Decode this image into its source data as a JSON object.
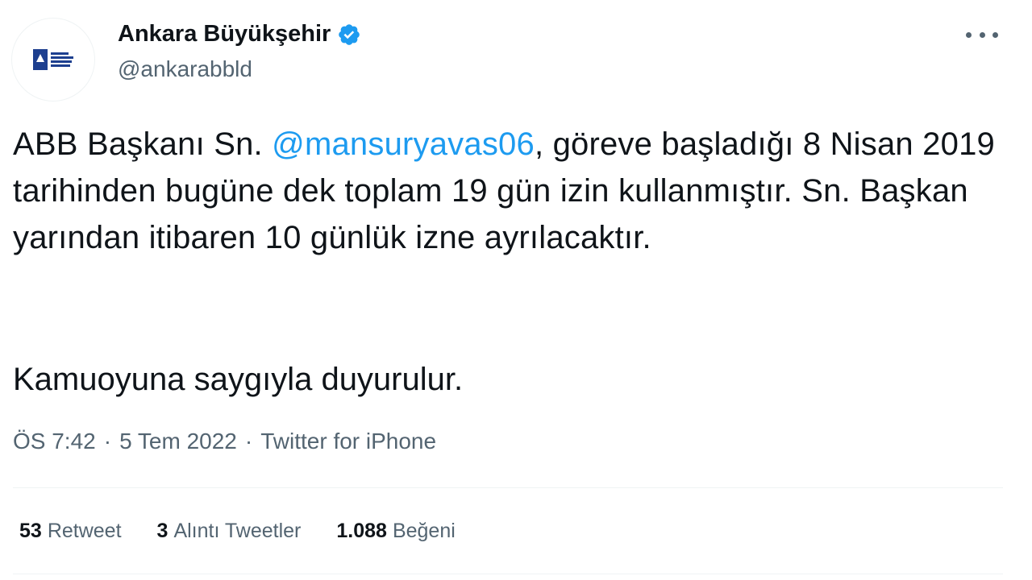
{
  "author": {
    "display_name": "Ankara Büyükşehir",
    "handle": "@ankarabbld",
    "verified": true,
    "avatar_icon": "ankara-municipality-logo",
    "verified_color": "#1d9bf0"
  },
  "more_icon": "more-horizontal-icon",
  "tweet": {
    "text_before": "ABB Başkanı Sn. ",
    "mention": "@mansuryavas06",
    "text_after": ", göreve başladığı 8 Nisan 2019 tarihinden bugüne dek toplam 19 gün izin kullanmıştır. Sn. Başkan yarından itibaren 10 günlük izne ayrılacaktır.",
    "closing": "Kamuoyuna saygıyla duyurulur."
  },
  "meta": {
    "time": "ÖS 7:42",
    "separator": "·",
    "date": "5 Tem 2022",
    "source": "Twitter for iPhone"
  },
  "stats": {
    "retweets_count": "53",
    "retweets_label": "Retweet",
    "quotes_count": "3",
    "quotes_label": "Alıntı Tweetler",
    "likes_count": "1.088",
    "likes_label": "Beğeni"
  },
  "colors": {
    "link": "#1d9bf0",
    "secondary_text": "#536471",
    "primary_text": "#0f1419",
    "divider": "#eff3f4"
  }
}
